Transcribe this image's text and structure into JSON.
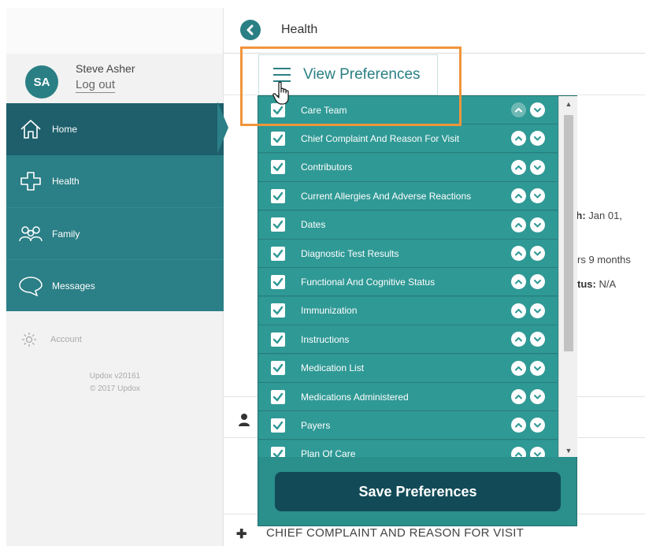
{
  "header": {
    "title": "Health",
    "back_icon": "chevron-left-icon"
  },
  "user": {
    "initials": "SA",
    "name": "Steve Asher",
    "logout": "Log out"
  },
  "sidebar": {
    "items": [
      {
        "label": "Home",
        "icon": "home-icon"
      },
      {
        "label": "Health",
        "icon": "plus-icon"
      },
      {
        "label": "Family",
        "icon": "family-icon"
      },
      {
        "label": "Messages",
        "icon": "chat-bubble-icon"
      }
    ],
    "account": "Account",
    "version": "Updox v20161",
    "copyright": "© 2017 Updox"
  },
  "background": {
    "birth_label": "rth:",
    "birth_value": "Jan 01,",
    "age_value": "rs 9 months",
    "status_label": "tus:",
    "status_value": "N/A",
    "section_label": "CHIEF COMPLAINT AND REASON FOR VISIT"
  },
  "preferences": {
    "button_label": "View Preferences",
    "save_label": "Save Preferences",
    "items": [
      {
        "label": "Care Team",
        "checked": true
      },
      {
        "label": "Chief Complaint And Reason For Visit",
        "checked": true
      },
      {
        "label": "Contributors",
        "checked": true
      },
      {
        "label": "Current Allergies And Adverse Reactions",
        "checked": true
      },
      {
        "label": "Dates",
        "checked": true
      },
      {
        "label": "Diagnostic Test Results",
        "checked": true
      },
      {
        "label": "Functional And Cognitive Status",
        "checked": true
      },
      {
        "label": "Immunization",
        "checked": true
      },
      {
        "label": "Instructions",
        "checked": true
      },
      {
        "label": "Medication List",
        "checked": true
      },
      {
        "label": "Medications Administered",
        "checked": true
      },
      {
        "label": "Payers",
        "checked": true
      },
      {
        "label": "Plan Of Care",
        "checked": true
      }
    ]
  },
  "colors": {
    "teal": "#2b7f86",
    "dark_teal": "#1e5f6b",
    "dropdown": "#2f9995",
    "save": "#124b57",
    "highlight": "#f0953b"
  }
}
